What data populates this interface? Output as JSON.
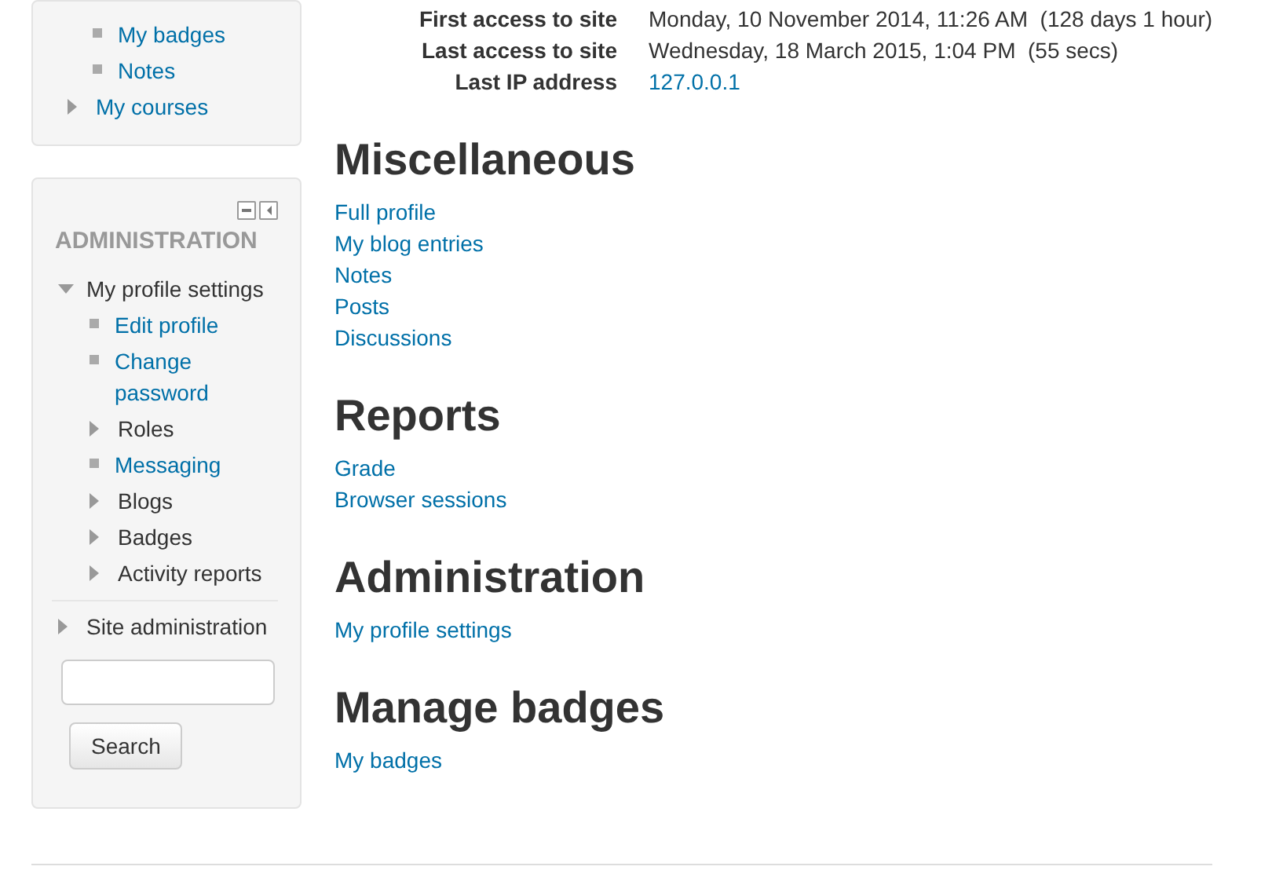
{
  "navigation_block": {
    "items": [
      {
        "label": "My badges",
        "kind": "leaf",
        "link": true
      },
      {
        "label": "Notes",
        "kind": "leaf",
        "link": true
      },
      {
        "label": "My courses",
        "kind": "branch",
        "expanded": false,
        "link": true
      }
    ]
  },
  "administration_block": {
    "title": "ADMINISTRATION",
    "items": [
      {
        "label": "My profile settings",
        "kind": "branch",
        "expanded": true,
        "link": false,
        "children": [
          {
            "label": "Edit profile",
            "kind": "leaf",
            "link": true
          },
          {
            "label": "Change password",
            "kind": "leaf",
            "link": true
          },
          {
            "label": "Roles",
            "kind": "branch",
            "expanded": false,
            "link": false
          },
          {
            "label": "Messaging",
            "kind": "leaf",
            "link": true
          },
          {
            "label": "Blogs",
            "kind": "branch",
            "expanded": false,
            "link": false
          },
          {
            "label": "Badges",
            "kind": "branch",
            "expanded": false,
            "link": false
          },
          {
            "label": "Activity reports",
            "kind": "branch",
            "expanded": false,
            "link": false
          }
        ]
      },
      {
        "label": "Site administration",
        "kind": "branch",
        "expanded": false,
        "link": false
      }
    ],
    "search_button": "Search"
  },
  "profile_details": [
    {
      "label": "First access to site",
      "value": "Monday, 10 November 2014, 11:26 AM  (128 days 1 hour)",
      "kind": "text"
    },
    {
      "label": "Last access to site",
      "value": "Wednesday, 18 March 2015, 1:04 PM  (55 secs)",
      "kind": "text"
    },
    {
      "label": "Last IP address",
      "value": "127.0.0.1",
      "kind": "link"
    }
  ],
  "sections": [
    {
      "title": "Miscellaneous",
      "links": [
        "Full profile",
        "My blog entries",
        "Notes",
        "Posts",
        "Discussions"
      ]
    },
    {
      "title": "Reports",
      "links": [
        "Grade",
        "Browser sessions"
      ]
    },
    {
      "title": "Administration",
      "links": [
        "My profile settings"
      ]
    },
    {
      "title": "Manage badges",
      "links": [
        "My badges"
      ]
    }
  ]
}
